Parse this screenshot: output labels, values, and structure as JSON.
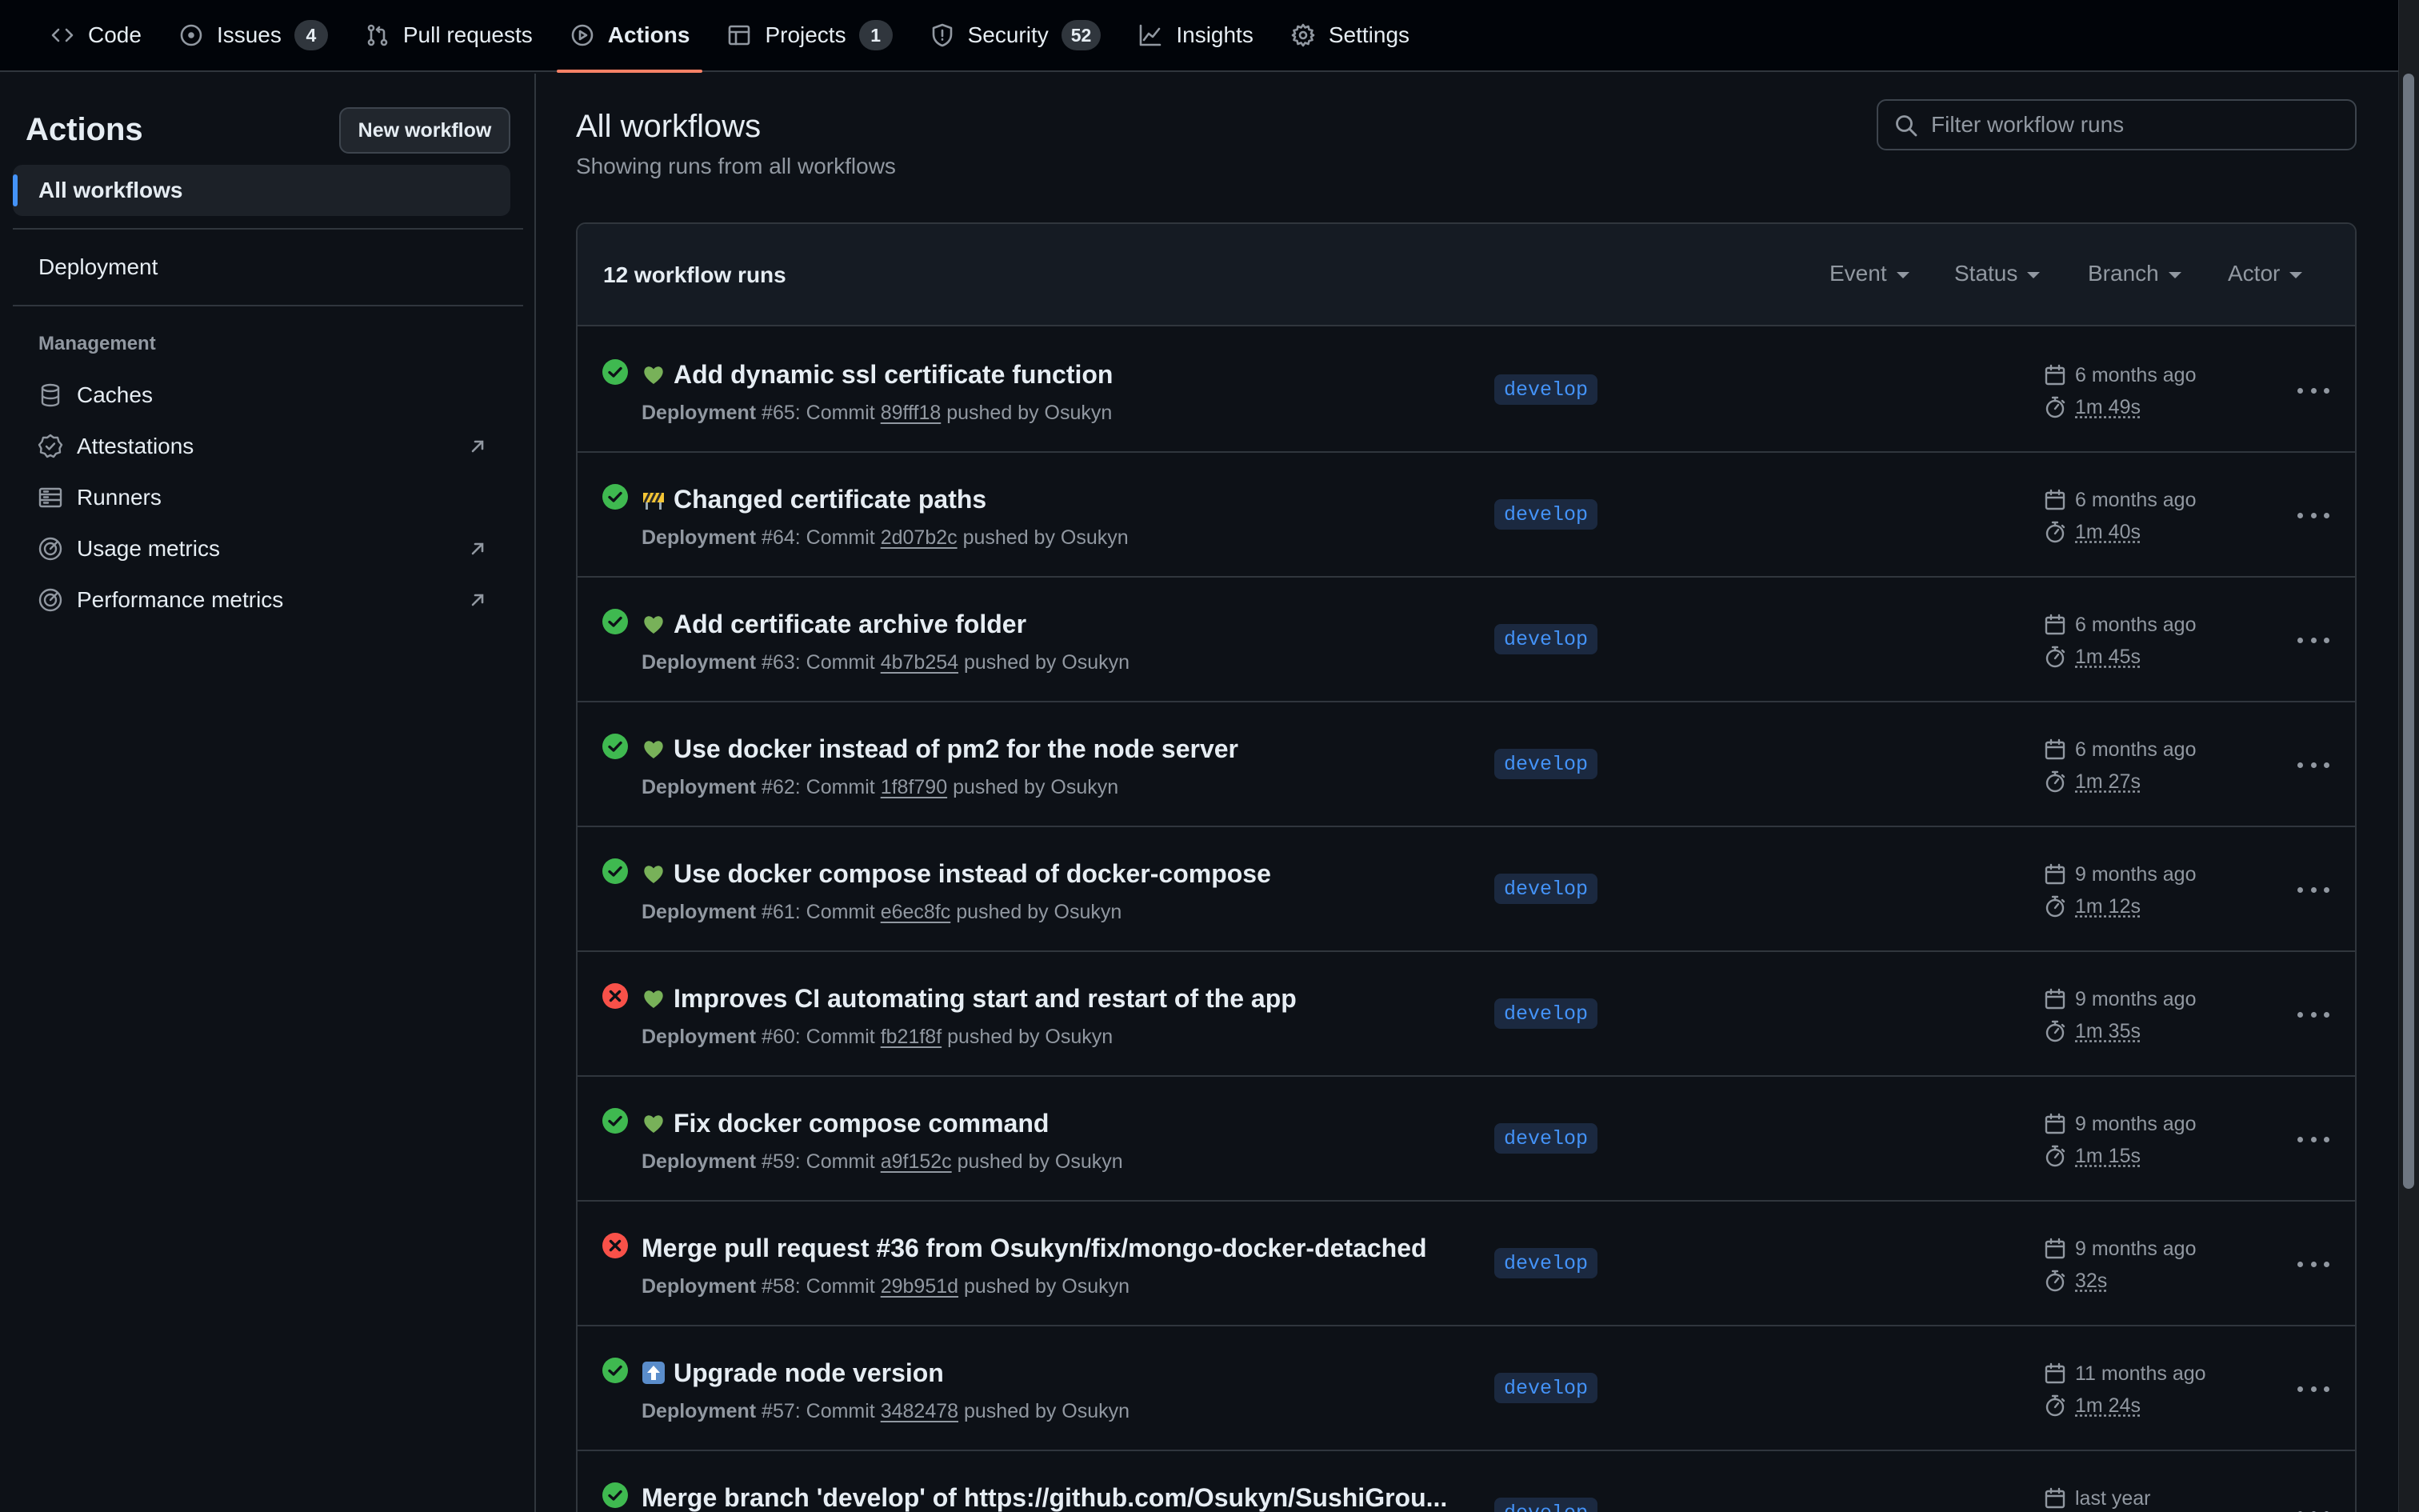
{
  "nav": {
    "tabs": [
      {
        "label": "Code",
        "icon": "code-icon"
      },
      {
        "label": "Issues",
        "icon": "issue-icon",
        "count": "4"
      },
      {
        "label": "Pull requests",
        "icon": "pull-request-icon"
      },
      {
        "label": "Actions",
        "icon": "play-icon",
        "active": true
      },
      {
        "label": "Projects",
        "icon": "table-icon",
        "count": "1"
      },
      {
        "label": "Security",
        "icon": "shield-icon",
        "count": "52"
      },
      {
        "label": "Insights",
        "icon": "graph-icon"
      },
      {
        "label": "Settings",
        "icon": "gear-icon"
      }
    ]
  },
  "sidebar": {
    "title": "Actions",
    "new_workflow": "New workflow",
    "all_workflows": "All workflows",
    "workflows": [
      "Deployment"
    ],
    "management_heading": "Management",
    "management": [
      {
        "label": "Caches",
        "icon": "database-icon",
        "external": false
      },
      {
        "label": "Attestations",
        "icon": "verified-icon",
        "external": true
      },
      {
        "label": "Runners",
        "icon": "server-icon",
        "external": false
      },
      {
        "label": "Usage metrics",
        "icon": "meter-icon",
        "external": true
      },
      {
        "label": "Performance metrics",
        "icon": "meter-icon",
        "external": true
      }
    ]
  },
  "main": {
    "title": "All workflows",
    "subtitle": "Showing runs from all workflows",
    "filter_placeholder": "Filter workflow runs",
    "runs_count": "12 workflow runs",
    "header_filters": [
      "Event",
      "Status",
      "Branch",
      "Actor"
    ]
  },
  "runs": [
    {
      "status": "success",
      "emoji": "green-heart",
      "title": "Add dynamic ssl certificate function",
      "workflow": "Deployment",
      "number": "#65",
      "commit": "89fff18",
      "actor": "Osukyn",
      "branch": "develop",
      "when": "6 months ago",
      "duration": "1m 49s"
    },
    {
      "status": "success",
      "emoji": "construction",
      "title": "Changed certificate paths",
      "workflow": "Deployment",
      "number": "#64",
      "commit": "2d07b2c",
      "actor": "Osukyn",
      "branch": "develop",
      "when": "6 months ago",
      "duration": "1m 40s"
    },
    {
      "status": "success",
      "emoji": "green-heart",
      "title": "Add certificate archive folder",
      "workflow": "Deployment",
      "number": "#63",
      "commit": "4b7b254",
      "actor": "Osukyn",
      "branch": "develop",
      "when": "6 months ago",
      "duration": "1m 45s"
    },
    {
      "status": "success",
      "emoji": "green-heart",
      "title": "Use docker instead of pm2 for the node server",
      "workflow": "Deployment",
      "number": "#62",
      "commit": "1f8f790",
      "actor": "Osukyn",
      "branch": "develop",
      "when": "6 months ago",
      "duration": "1m 27s"
    },
    {
      "status": "success",
      "emoji": "green-heart",
      "title": "Use docker compose instead of docker-compose",
      "workflow": "Deployment",
      "number": "#61",
      "commit": "e6ec8fc",
      "actor": "Osukyn",
      "branch": "develop",
      "when": "9 months ago",
      "duration": "1m 12s"
    },
    {
      "status": "failure",
      "emoji": "green-heart",
      "title": "Improves CI automating start and restart of the app",
      "workflow": "Deployment",
      "number": "#60",
      "commit": "fb21f8f",
      "actor": "Osukyn",
      "branch": "develop",
      "when": "9 months ago",
      "duration": "1m 35s"
    },
    {
      "status": "success",
      "emoji": "green-heart",
      "title": "Fix docker compose command",
      "workflow": "Deployment",
      "number": "#59",
      "commit": "a9f152c",
      "actor": "Osukyn",
      "branch": "develop",
      "when": "9 months ago",
      "duration": "1m 15s"
    },
    {
      "status": "failure",
      "emoji": "",
      "title": "Merge pull request #36 from Osukyn/fix/mongo-docker-detached",
      "workflow": "Deployment",
      "number": "#58",
      "commit": "29b951d",
      "actor": "Osukyn",
      "branch": "develop",
      "when": "9 months ago",
      "duration": "32s"
    },
    {
      "status": "success",
      "emoji": "up-arrow",
      "title": "Upgrade node version",
      "workflow": "Deployment",
      "number": "#57",
      "commit": "3482478",
      "actor": "Osukyn",
      "branch": "develop",
      "when": "11 months ago",
      "duration": "1m 24s"
    },
    {
      "status": "success",
      "emoji": "",
      "title": "Merge branch 'develop' of https://github.com/Osukyn/SushiGrou...",
      "workflow": "",
      "number": "",
      "commit": "",
      "actor": "",
      "branch": "develop",
      "when": "last year",
      "duration": ""
    }
  ],
  "meta_words": {
    "commit": "Commit",
    "pushed_by": "pushed by"
  },
  "colors": {
    "success": "#3fb950",
    "failure": "#f85149",
    "accent": "#f78166",
    "link": "#4493f8"
  }
}
